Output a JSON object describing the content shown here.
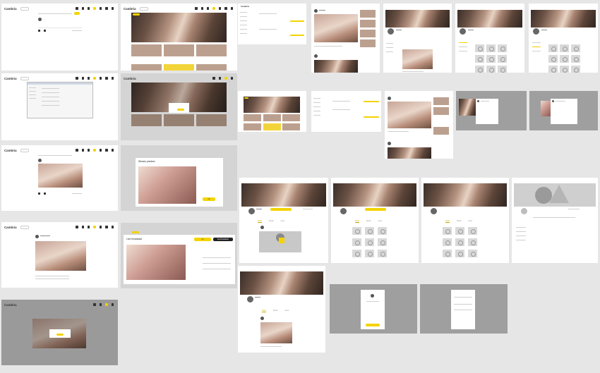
{
  "app": {
    "name": "Cambria",
    "search_placeholder": "Search"
  },
  "labels": {
    "logo": "Cambria",
    "stream_preview": "Stream preview",
    "live_broadcast": "Live broadcast",
    "button_ok": "Ok",
    "button_go_live": "Go",
    "button_end_broadcast": "End broadcast",
    "badge_live": "LIVE",
    "profile_name": "Name",
    "username": "Username",
    "follow_button": "Follow",
    "tab_posts": "Posts",
    "tab_media": "Media",
    "tab_likes": "Likes",
    "modal_button": "Ok"
  },
  "colors": {
    "accent": "#f4d300",
    "background": "#e6e6e6",
    "dim_overlay": "#9a9a9a"
  },
  "icons": [
    "camera-icon",
    "home-icon",
    "chat-icon",
    "star-icon",
    "settings-icon",
    "bell-icon",
    "avatar-icon"
  ]
}
